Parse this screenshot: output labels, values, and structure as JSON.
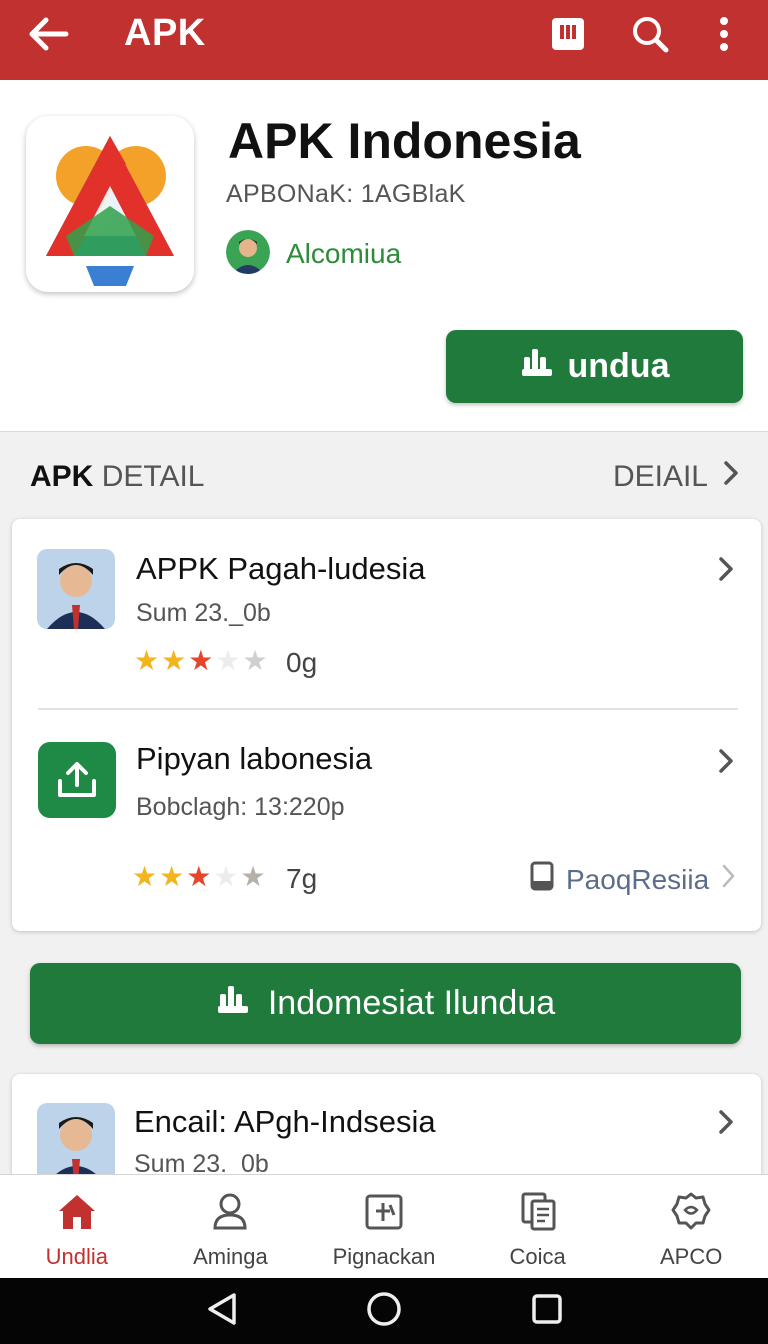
{
  "appbar": {
    "title": "APK",
    "icons": [
      "back-arrow-icon",
      "stats-icon",
      "search-icon",
      "more-vert-icon"
    ]
  },
  "header": {
    "app_name": "APK Indonesia",
    "subtitle": "APBONaK: 1AGBlaK",
    "developer": "Alcomiua",
    "download_label": "undua"
  },
  "section": {
    "title_bold": "APK",
    "title_rest": "DETAIL",
    "link_label": "DEIAIL"
  },
  "list": [
    {
      "title": "APPK Pagah-ludesia",
      "subtitle": "Sum 23._0b",
      "rating_text": "0g",
      "stars": 3
    },
    {
      "title": "Pipyan labonesia",
      "subtitle": "Bobclagh: 13:220p",
      "rating_text": "7g",
      "stars": 3,
      "tag": "PaoqResiia"
    }
  ],
  "big_download": {
    "label": "Indomesiat Ilundua"
  },
  "list2": [
    {
      "title": "Encail: APgh-Indsesia",
      "subtitle": "Sum 23._0b"
    }
  ],
  "bottom_nav": [
    {
      "label": "Undlia",
      "icon": "home-icon",
      "active": true
    },
    {
      "label": "Aminga",
      "icon": "person-icon",
      "active": false
    },
    {
      "label": "Pignackan",
      "icon": "package-icon",
      "active": false
    },
    {
      "label": "Coica",
      "icon": "document-icon",
      "active": false
    },
    {
      "label": "APCO",
      "icon": "badge-icon",
      "active": false
    }
  ],
  "colors": {
    "primary": "#c0312f",
    "green": "#1f7a3c",
    "developer_green": "#2e8b3a",
    "star_gold": "#f2b51c",
    "star_red": "#e5452b",
    "star_empty": "#cfcfcf"
  }
}
